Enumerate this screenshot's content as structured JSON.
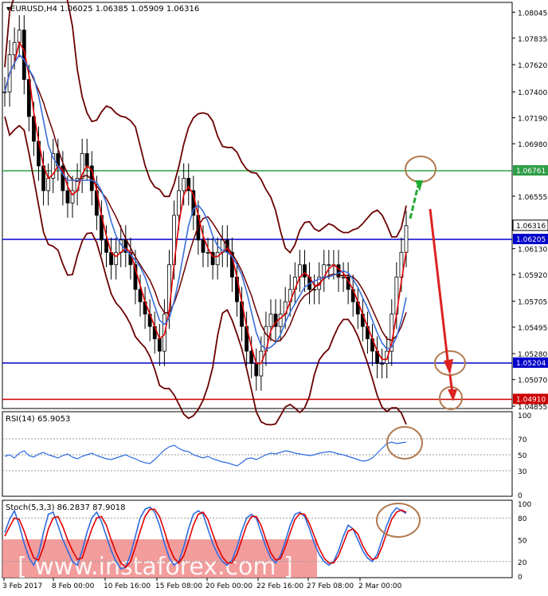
{
  "header": {
    "symbol": "EURUSD,H4",
    "ohlc": "1.06025 1.06385 1.05909 1.06316"
  },
  "colors": {
    "candle": "#000000",
    "bollinger": "#6b0000",
    "ma_fast": "#e00000",
    "ma_slow": "#3a6fd8",
    "resistance_line": "#2e9e48",
    "support_line": "#0000cc",
    "low_line": "#cc0000",
    "annotation_circle": "#b07a50",
    "arrow_up": "#22aa33",
    "arrow_down": "#dd2222",
    "rsi": "#2e6be0",
    "stoch_main": "#2e6be0",
    "stoch_signal": "#e00000",
    "watermark_band": "#f08b8b"
  },
  "chart_data": [
    {
      "type": "line",
      "name": "price",
      "ylim": [
        1.04855,
        1.08105
      ],
      "y_ticks": [
        "1.08045",
        "1.07835",
        "1.07620",
        "1.07400",
        "1.07190",
        "1.06980",
        "1.06555",
        "1.06130",
        "1.05920",
        "1.05705",
        "1.05495",
        "1.05280",
        "1.05070",
        "1.04855"
      ],
      "current_price_label": "1.06316",
      "levels": [
        {
          "value": 1.06761,
          "label": "1.06761",
          "color": "#2e9e48"
        },
        {
          "value": 1.06205,
          "label": "1.06205",
          "color": "#0000cc"
        },
        {
          "value": 1.05204,
          "label": "1.05204",
          "color": "#0000cc"
        },
        {
          "value": 1.0491,
          "label": "1.04910",
          "color": "#cc0000"
        }
      ],
      "close_path": [
        1.074,
        1.077,
        1.078,
        1.079,
        1.075,
        1.072,
        1.07,
        1.068,
        1.066,
        1.067,
        1.069,
        1.068,
        1.066,
        1.065,
        1.066,
        1.067,
        1.069,
        1.068,
        1.066,
        1.064,
        1.062,
        1.061,
        1.06,
        1.061,
        1.062,
        1.061,
        1.06,
        1.058,
        1.057,
        1.056,
        1.055,
        1.054,
        1.053,
        1.056,
        1.06,
        1.064,
        1.066,
        1.067,
        1.066,
        1.064,
        1.062,
        1.061,
        1.061,
        1.06,
        1.061,
        1.062,
        1.061,
        1.059,
        1.057,
        1.055,
        1.053,
        1.052,
        1.051,
        1.053,
        1.055,
        1.056,
        1.055,
        1.056,
        1.057,
        1.058,
        1.059,
        1.06,
        1.059,
        1.058,
        1.058,
        1.059,
        1.06,
        1.06,
        1.06,
        1.059,
        1.059,
        1.058,
        1.057,
        1.056,
        1.055,
        1.054,
        1.053,
        1.052,
        1.052,
        1.053,
        1.056,
        1.059,
        1.061,
        1.06316
      ]
    },
    {
      "type": "line",
      "name": "RSI(14)",
      "title": "RSI(14) 65.9053",
      "ylim": [
        0,
        100
      ],
      "y_ticks": [
        "100",
        "70",
        "50",
        "30",
        "0"
      ],
      "levels": [
        70,
        50,
        30
      ],
      "values": [
        48,
        50,
        46,
        52,
        55,
        49,
        47,
        51,
        53,
        50,
        48,
        46,
        49,
        51,
        47,
        45,
        48,
        50,
        52,
        49,
        47,
        45,
        44,
        46,
        48,
        50,
        47,
        45,
        42,
        40,
        39,
        44,
        50,
        56,
        60,
        62,
        58,
        55,
        54,
        50,
        48,
        46,
        48,
        45,
        43,
        41,
        40,
        38,
        36,
        40,
        45,
        46,
        44,
        47,
        50,
        52,
        51,
        53,
        55,
        54,
        52,
        51,
        50,
        49,
        50,
        52,
        53,
        54,
        53,
        51,
        50,
        48,
        46,
        44,
        42,
        43,
        46,
        52,
        58,
        64,
        66,
        64,
        65,
        65.9053
      ]
    },
    {
      "type": "line",
      "name": "Stoch(5,3,3)",
      "title": "Stoch(5,3,3) 86.2837 87.9018",
      "ylim": [
        0,
        100
      ],
      "y_ticks": [
        "100",
        "80",
        "50",
        "20",
        "0"
      ],
      "levels": [
        80,
        20
      ],
      "main": [
        60,
        78,
        90,
        70,
        45,
        25,
        15,
        30,
        60,
        85,
        88,
        70,
        50,
        35,
        20,
        15,
        35,
        60,
        80,
        88,
        75,
        55,
        35,
        20,
        10,
        12,
        30,
        55,
        80,
        92,
        95,
        88,
        70,
        45,
        25,
        15,
        20,
        40,
        65,
        85,
        90,
        85,
        65,
        45,
        30,
        20,
        15,
        22,
        40,
        62,
        80,
        85,
        80,
        60,
        40,
        25,
        18,
        28,
        48,
        70,
        85,
        88,
        82,
        65,
        45,
        30,
        20,
        15,
        20,
        35,
        55,
        70,
        65,
        50,
        35,
        25,
        20,
        30,
        50,
        70,
        86,
        94,
        90,
        86.2837
      ],
      "signal": [
        55,
        68,
        80,
        78,
        62,
        42,
        25,
        22,
        40,
        65,
        80,
        82,
        68,
        50,
        35,
        23,
        25,
        45,
        65,
        80,
        82,
        70,
        50,
        32,
        18,
        12,
        20,
        40,
        62,
        82,
        92,
        92,
        82,
        62,
        40,
        25,
        18,
        28,
        48,
        70,
        85,
        88,
        78,
        58,
        40,
        26,
        18,
        18,
        30,
        50,
        70,
        82,
        82,
        70,
        50,
        32,
        22,
        24,
        40,
        60,
        78,
        86,
        85,
        72,
        55,
        38,
        25,
        18,
        18,
        28,
        45,
        62,
        65,
        58,
        42,
        30,
        23,
        25,
        40,
        60,
        78,
        88,
        91,
        87.9018
      ]
    }
  ],
  "x_axis": {
    "labels": [
      "3 Feb 2017",
      "8 Feb 00:00",
      "10 Feb 16:00",
      "15 Feb 08:00",
      "20 Feb 00:00",
      "22 Feb 16:00",
      "27 Feb 08:00",
      "2 Mar 00:00"
    ]
  },
  "watermark": {
    "text": "[ www.instaforex.com ]"
  }
}
